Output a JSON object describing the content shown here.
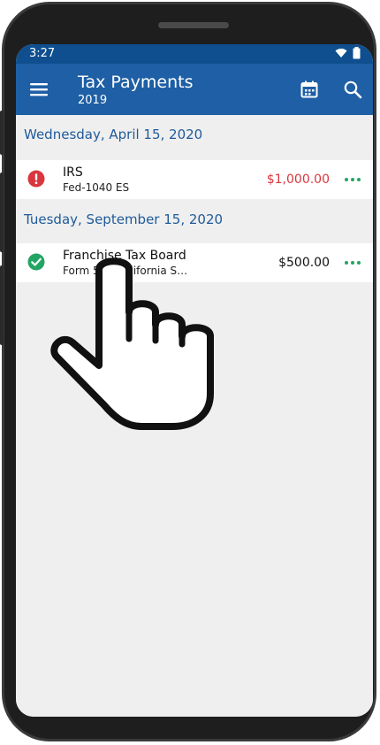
{
  "status_bar": {
    "time": "3:27"
  },
  "app_bar": {
    "title": "Tax Payments",
    "subtitle": "2019",
    "menu_icon": "menu-icon",
    "calendar_icon": "calendar-icon",
    "search_icon": "search-icon"
  },
  "groups": [
    {
      "date": "Wednesday, April 15, 2020",
      "payments": [
        {
          "payee": "IRS",
          "detail": "Fed-1040 ES",
          "amount": "$1,000.00",
          "status": "alert",
          "status_icon": "alert-icon"
        }
      ]
    },
    {
      "date": "Tuesday, September 15, 2020",
      "payments": [
        {
          "payee": "Franchise Tax Board",
          "detail": "Form 540 California S…",
          "amount": "$500.00",
          "status": "complete",
          "status_icon": "check-icon"
        }
      ]
    }
  ],
  "colors": {
    "status_bar": "#0f4f8f",
    "app_bar": "#1e5fa5",
    "date_header": "#1f5a9a",
    "alert": "#d9363e",
    "complete": "#22a564",
    "more": "#22a564",
    "background": "#efefef"
  }
}
